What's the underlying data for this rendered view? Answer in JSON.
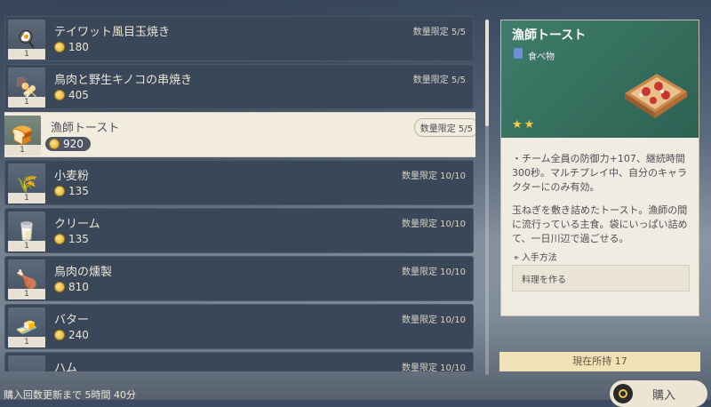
{
  "items": [
    {
      "name": "テイワット風目玉焼き",
      "price": "180",
      "limit": "数量限定 5/5",
      "qty": "1",
      "icon": "egg-icon",
      "glyph": "🍳"
    },
    {
      "name": "鳥肉と野生キノコの串焼き",
      "price": "405",
      "limit": "数量限定 5/5",
      "qty": "1",
      "icon": "skewer-icon",
      "glyph": "🍢"
    },
    {
      "name": "漁師トースト",
      "price": "920",
      "limit": "数量限定 5/5",
      "qty": "1",
      "icon": "toast-icon",
      "glyph": "🍞",
      "selected": true
    },
    {
      "name": "小麦粉",
      "price": "135",
      "limit": "数量限定 10/10",
      "qty": "1",
      "icon": "flour-icon",
      "glyph": "🌾"
    },
    {
      "name": "クリーム",
      "price": "135",
      "limit": "数量限定 10/10",
      "qty": "1",
      "icon": "cream-icon",
      "glyph": "🥛"
    },
    {
      "name": "鳥肉の燻製",
      "price": "810",
      "limit": "数量限定 10/10",
      "qty": "1",
      "icon": "smoked-meat-icon",
      "glyph": "🍗"
    },
    {
      "name": "バター",
      "price": "240",
      "limit": "数量限定 10/10",
      "qty": "1",
      "icon": "butter-icon",
      "glyph": "🧈"
    },
    {
      "name": "ハム",
      "price": "",
      "limit": "数量限定 10/10",
      "qty": "",
      "icon": "ham-icon",
      "glyph": ""
    }
  ],
  "detail": {
    "title": "漁師トースト",
    "type": "食べ物",
    "stars": "★★",
    "effect": "・チーム全員の防御力+107、継続時間300秒。マルチプレイ中、自分のキャラクターにのみ有効。",
    "description": "玉ねぎを敷き詰めたトースト。漁師の間に流行っている主食。袋にいっぱい詰めて、一日川辺で過ごせる。",
    "source_label": "入手方法",
    "source_value": "料理を作る"
  },
  "owned": "現在所持 17",
  "footer": "購入回数更新まで 5時間 40分",
  "buy_label": "購入"
}
